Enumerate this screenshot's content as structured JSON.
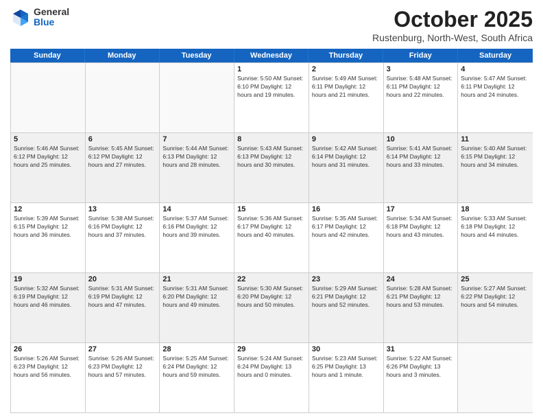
{
  "header": {
    "logo_general": "General",
    "logo_blue": "Blue",
    "month": "October 2025",
    "location": "Rustenburg, North-West, South Africa"
  },
  "days_of_week": [
    "Sunday",
    "Monday",
    "Tuesday",
    "Wednesday",
    "Thursday",
    "Friday",
    "Saturday"
  ],
  "weeks": [
    [
      {
        "day": "",
        "info": ""
      },
      {
        "day": "",
        "info": ""
      },
      {
        "day": "",
        "info": ""
      },
      {
        "day": "1",
        "info": "Sunrise: 5:50 AM\nSunset: 6:10 PM\nDaylight: 12 hours\nand 19 minutes."
      },
      {
        "day": "2",
        "info": "Sunrise: 5:49 AM\nSunset: 6:11 PM\nDaylight: 12 hours\nand 21 minutes."
      },
      {
        "day": "3",
        "info": "Sunrise: 5:48 AM\nSunset: 6:11 PM\nDaylight: 12 hours\nand 22 minutes."
      },
      {
        "day": "4",
        "info": "Sunrise: 5:47 AM\nSunset: 6:11 PM\nDaylight: 12 hours\nand 24 minutes."
      }
    ],
    [
      {
        "day": "5",
        "info": "Sunrise: 5:46 AM\nSunset: 6:12 PM\nDaylight: 12 hours\nand 25 minutes."
      },
      {
        "day": "6",
        "info": "Sunrise: 5:45 AM\nSunset: 6:12 PM\nDaylight: 12 hours\nand 27 minutes."
      },
      {
        "day": "7",
        "info": "Sunrise: 5:44 AM\nSunset: 6:13 PM\nDaylight: 12 hours\nand 28 minutes."
      },
      {
        "day": "8",
        "info": "Sunrise: 5:43 AM\nSunset: 6:13 PM\nDaylight: 12 hours\nand 30 minutes."
      },
      {
        "day": "9",
        "info": "Sunrise: 5:42 AM\nSunset: 6:14 PM\nDaylight: 12 hours\nand 31 minutes."
      },
      {
        "day": "10",
        "info": "Sunrise: 5:41 AM\nSunset: 6:14 PM\nDaylight: 12 hours\nand 33 minutes."
      },
      {
        "day": "11",
        "info": "Sunrise: 5:40 AM\nSunset: 6:15 PM\nDaylight: 12 hours\nand 34 minutes."
      }
    ],
    [
      {
        "day": "12",
        "info": "Sunrise: 5:39 AM\nSunset: 6:15 PM\nDaylight: 12 hours\nand 36 minutes."
      },
      {
        "day": "13",
        "info": "Sunrise: 5:38 AM\nSunset: 6:16 PM\nDaylight: 12 hours\nand 37 minutes."
      },
      {
        "day": "14",
        "info": "Sunrise: 5:37 AM\nSunset: 6:16 PM\nDaylight: 12 hours\nand 39 minutes."
      },
      {
        "day": "15",
        "info": "Sunrise: 5:36 AM\nSunset: 6:17 PM\nDaylight: 12 hours\nand 40 minutes."
      },
      {
        "day": "16",
        "info": "Sunrise: 5:35 AM\nSunset: 6:17 PM\nDaylight: 12 hours\nand 42 minutes."
      },
      {
        "day": "17",
        "info": "Sunrise: 5:34 AM\nSunset: 6:18 PM\nDaylight: 12 hours\nand 43 minutes."
      },
      {
        "day": "18",
        "info": "Sunrise: 5:33 AM\nSunset: 6:18 PM\nDaylight: 12 hours\nand 44 minutes."
      }
    ],
    [
      {
        "day": "19",
        "info": "Sunrise: 5:32 AM\nSunset: 6:19 PM\nDaylight: 12 hours\nand 46 minutes."
      },
      {
        "day": "20",
        "info": "Sunrise: 5:31 AM\nSunset: 6:19 PM\nDaylight: 12 hours\nand 47 minutes."
      },
      {
        "day": "21",
        "info": "Sunrise: 5:31 AM\nSunset: 6:20 PM\nDaylight: 12 hours\nand 49 minutes."
      },
      {
        "day": "22",
        "info": "Sunrise: 5:30 AM\nSunset: 6:20 PM\nDaylight: 12 hours\nand 50 minutes."
      },
      {
        "day": "23",
        "info": "Sunrise: 5:29 AM\nSunset: 6:21 PM\nDaylight: 12 hours\nand 52 minutes."
      },
      {
        "day": "24",
        "info": "Sunrise: 5:28 AM\nSunset: 6:21 PM\nDaylight: 12 hours\nand 53 minutes."
      },
      {
        "day": "25",
        "info": "Sunrise: 5:27 AM\nSunset: 6:22 PM\nDaylight: 12 hours\nand 54 minutes."
      }
    ],
    [
      {
        "day": "26",
        "info": "Sunrise: 5:26 AM\nSunset: 6:23 PM\nDaylight: 12 hours\nand 56 minutes."
      },
      {
        "day": "27",
        "info": "Sunrise: 5:26 AM\nSunset: 6:23 PM\nDaylight: 12 hours\nand 57 minutes."
      },
      {
        "day": "28",
        "info": "Sunrise: 5:25 AM\nSunset: 6:24 PM\nDaylight: 12 hours\nand 59 minutes."
      },
      {
        "day": "29",
        "info": "Sunrise: 5:24 AM\nSunset: 6:24 PM\nDaylight: 13 hours\nand 0 minutes."
      },
      {
        "day": "30",
        "info": "Sunrise: 5:23 AM\nSunset: 6:25 PM\nDaylight: 13 hours\nand 1 minute."
      },
      {
        "day": "31",
        "info": "Sunrise: 5:22 AM\nSunset: 6:26 PM\nDaylight: 13 hours\nand 3 minutes."
      },
      {
        "day": "",
        "info": ""
      }
    ]
  ]
}
